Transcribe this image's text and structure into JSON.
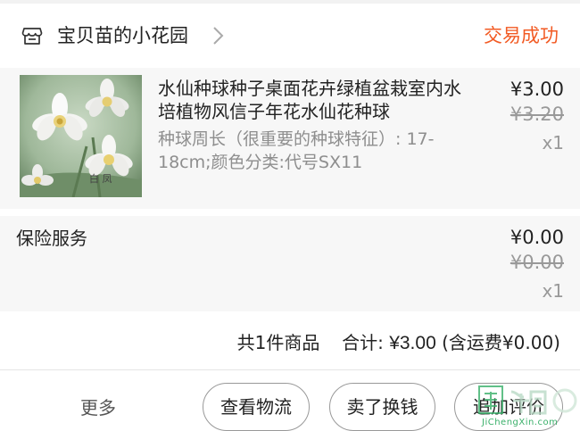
{
  "shop": {
    "name": "宝贝苗的小花园",
    "status": "交易成功"
  },
  "product": {
    "title": "水仙种球种子桌面花卉绿植盆栽室内水培植物风信子年花水仙花种球",
    "sku": "种球周长（很重要的种球特征）: 17-18cm;颜色分类:代号SX11",
    "thumb_text": "白 凤",
    "price": "¥3.00",
    "original_price": "¥3.20",
    "quantity": "x1"
  },
  "insurance": {
    "label": "保险服务",
    "price": "¥0.00",
    "original_price": "¥0.00",
    "quantity": "x1"
  },
  "summary": {
    "count_text": "共1件商品",
    "total_label": "合计:",
    "total_value": "¥3.00",
    "shipping_text": "(含运费¥0.00)"
  },
  "actions": {
    "more": "更多",
    "logistics": "查看物流",
    "resell": "卖了换钱",
    "review": "追加评价"
  },
  "watermark": {
    "text": "JiChengXin.com"
  },
  "colors": {
    "status": "#f25a23",
    "row_bg": "#f7f7f7",
    "muted": "#999999"
  },
  "icons": {
    "shop": "shop-icon",
    "chevron": "chevron-right-icon"
  }
}
